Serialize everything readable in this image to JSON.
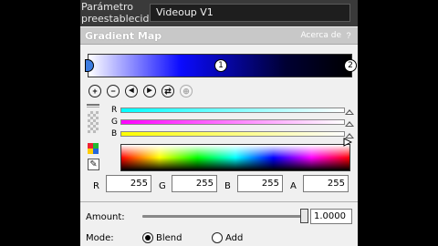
{
  "preset": {
    "label": "Parámetro preestablecido:",
    "value": "Videoup V1"
  },
  "panel": {
    "title": "Gradient Map",
    "about_label": "Acerca de",
    "help_glyph": "?"
  },
  "gradient": {
    "stops": [
      {
        "label": "",
        "color": "#3b7be0"
      },
      {
        "label": "1",
        "color": "#ffffff"
      },
      {
        "label": "2",
        "color": "#ffffff"
      }
    ],
    "colors": [
      "#ffffff",
      "#0b0bff",
      "#000033",
      "#000000"
    ]
  },
  "toolbar": {
    "buttons": [
      {
        "name": "add-stop-icon",
        "glyph": "+"
      },
      {
        "name": "remove-stop-icon",
        "glyph": "−"
      },
      {
        "name": "previous-stop-icon",
        "glyph": "◀"
      },
      {
        "name": "next-stop-icon",
        "glyph": "▶"
      },
      {
        "name": "flip-gradient-icon",
        "glyph": "⇄"
      },
      {
        "name": "globe-icon",
        "glyph": "⊕"
      }
    ]
  },
  "channels": [
    {
      "letter": "R",
      "color_from": "#00ffff",
      "color_to": "#ffffff"
    },
    {
      "letter": "G",
      "color_from": "#ff00ff",
      "color_to": "#ffffff"
    },
    {
      "letter": "B",
      "color_from": "#ffff00",
      "color_to": "#ffffff"
    }
  ],
  "rgba": {
    "r_label": "R",
    "r_value": "255",
    "g_label": "G",
    "g_value": "255",
    "b_label": "B",
    "b_value": "255",
    "a_label": "A",
    "a_value": "255"
  },
  "amount": {
    "label": "Amount:",
    "value": "1.0000",
    "slider_fraction": 1.0
  },
  "mode": {
    "label": "Mode:",
    "options": [
      {
        "label": "Blend",
        "selected": true
      },
      {
        "label": "Add",
        "selected": false
      }
    ]
  }
}
